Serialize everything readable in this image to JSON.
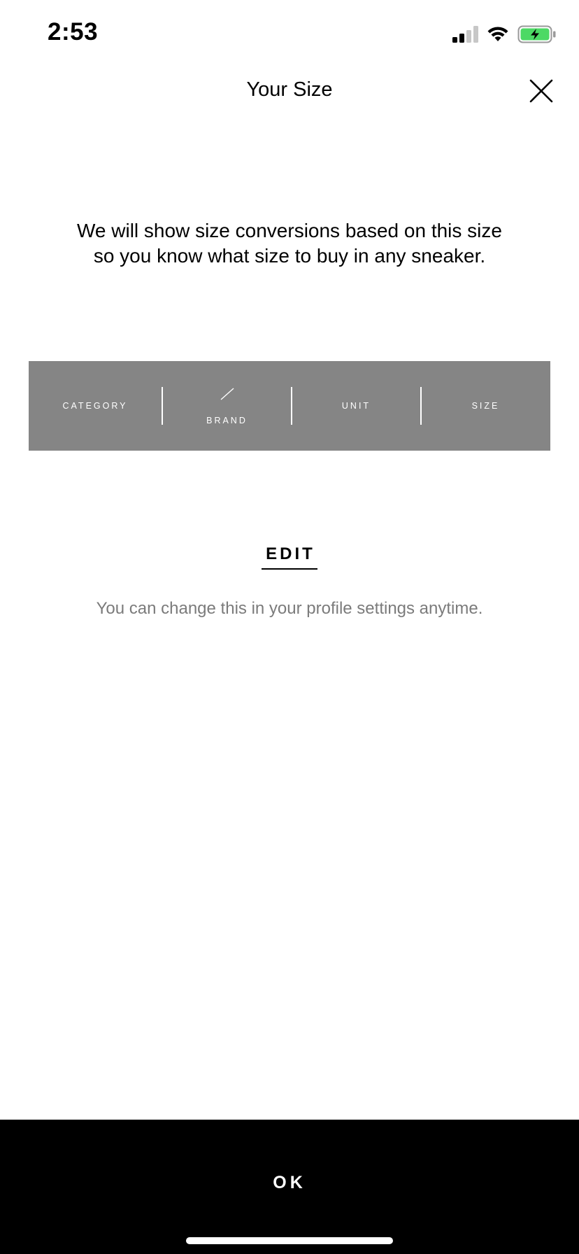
{
  "status_bar": {
    "time": "2:53",
    "icons": [
      "signal-icon",
      "wifi-icon",
      "battery-charging-icon"
    ],
    "battery_color": "#4cd964"
  },
  "header": {
    "title": "Your Size",
    "close_icon": "close-icon"
  },
  "intro": {
    "text": "We will show size conversions based on this size so you know what size to buy in any sneaker."
  },
  "size_bar": {
    "background": "#858585",
    "category_label": "CATEGORY",
    "brand_label": "BRAND",
    "unit_label": "UNIT",
    "size_label": "SIZE"
  },
  "edit": {
    "label": "EDIT"
  },
  "hint": {
    "text": "You can change this in your profile settings anytime."
  },
  "footer": {
    "ok_label": "OK"
  }
}
